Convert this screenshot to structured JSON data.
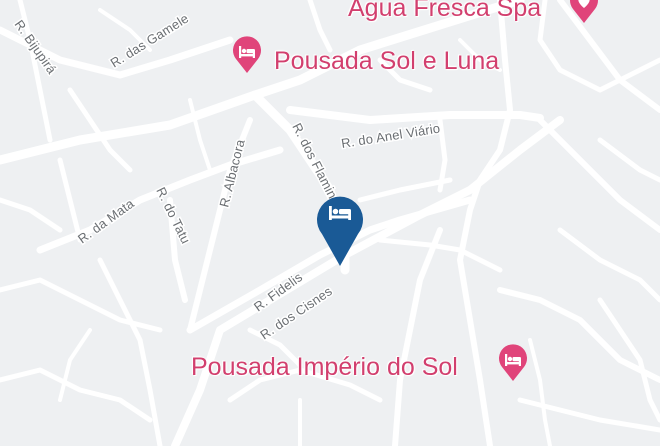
{
  "map": {
    "streets": {
      "bijupira": "R. Bijupirá",
      "gameleiras": "R. das Gamele",
      "anel_viario": "R. do Anel Viário",
      "albacora": "R. Albacora",
      "flamingos": "R. dos Flamingos",
      "da_mata": "R. da Mata",
      "do_tatu": "R. do Tatu",
      "fidelis": "R. Fidelis",
      "cisnes": "R. dos Cisnes"
    },
    "pois": {
      "agua_fresca": {
        "label": "Água Fresca Spa",
        "icon": "heart-pin-icon"
      },
      "pousada_sol_luna": {
        "label": "Pousada Sol e Luna",
        "icon": "hotel-bed-icon"
      },
      "pousada_imperio": {
        "label": "Pousada Império do Sol",
        "icon": "hotel-bed-icon"
      }
    },
    "selected_marker": {
      "icon": "hotel-bed-icon",
      "color": "#1a5a96"
    },
    "colors": {
      "background": "#eef0f2",
      "road": "#ffffff",
      "poi": "#e0447a"
    }
  }
}
